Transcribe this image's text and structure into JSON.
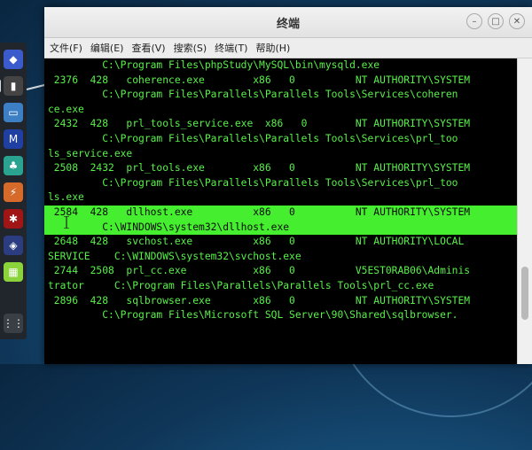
{
  "window": {
    "title": "终端"
  },
  "menu": [
    "文件(F)",
    "编辑(E)",
    "查看(V)",
    "搜索(S)",
    "终端(T)",
    "帮助(H)"
  ],
  "terminal_lines": [
    {
      "text": "         C:\\Program Files\\phpStudy\\MySQL\\bin\\mysqld.exe",
      "highlight": false
    },
    {
      "text": " 2376  428   coherence.exe        x86   0          NT AUTHORITY\\SYSTEM",
      "highlight": false
    },
    {
      "text": "         C:\\Program Files\\Parallels\\Parallels Tools\\Services\\coheren",
      "highlight": false
    },
    {
      "text": "ce.exe",
      "highlight": false
    },
    {
      "text": " 2432  428   prl_tools_service.exe  x86   0        NT AUTHORITY\\SYSTEM",
      "highlight": false
    },
    {
      "text": "         C:\\Program Files\\Parallels\\Parallels Tools\\Services\\prl_too",
      "highlight": false
    },
    {
      "text": "ls_service.exe",
      "highlight": false
    },
    {
      "text": " 2508  2432  prl_tools.exe        x86   0          NT AUTHORITY\\SYSTEM",
      "highlight": false
    },
    {
      "text": "         C:\\Program Files\\Parallels\\Parallels Tools\\Services\\prl_too",
      "highlight": false
    },
    {
      "text": "ls.exe",
      "highlight": false
    },
    {
      "text": " 2584  428   dllhost.exe          x86   0          NT AUTHORITY\\SYSTEM",
      "highlight": true
    },
    {
      "text": "         C:\\WINDOWS\\system32\\dllhost.exe",
      "highlight": true
    },
    {
      "text": " 2648  428   svchost.exe          x86   0          NT AUTHORITY\\LOCAL",
      "highlight": false
    },
    {
      "text": "SERVICE    C:\\WINDOWS\\system32\\svchost.exe",
      "highlight": false
    },
    {
      "text": " 2744  2508  prl_cc.exe           x86   0          V5EST0RAB06\\Adminis",
      "highlight": false
    },
    {
      "text": "trator     C:\\Program Files\\Parallels\\Parallels Tools\\prl_cc.exe",
      "highlight": false
    },
    {
      "text": " 2896  428   sqlbrowser.exe       x86   0          NT AUTHORITY\\SYSTEM",
      "highlight": false
    },
    {
      "text": "         C:\\Program Files\\Microsoft SQL Server\\90\\Shared\\sqlbrowser.",
      "highlight": false
    }
  ],
  "colors": {
    "text": "#59f04a",
    "highlight": "#45ee2e",
    "background": "#000000"
  }
}
